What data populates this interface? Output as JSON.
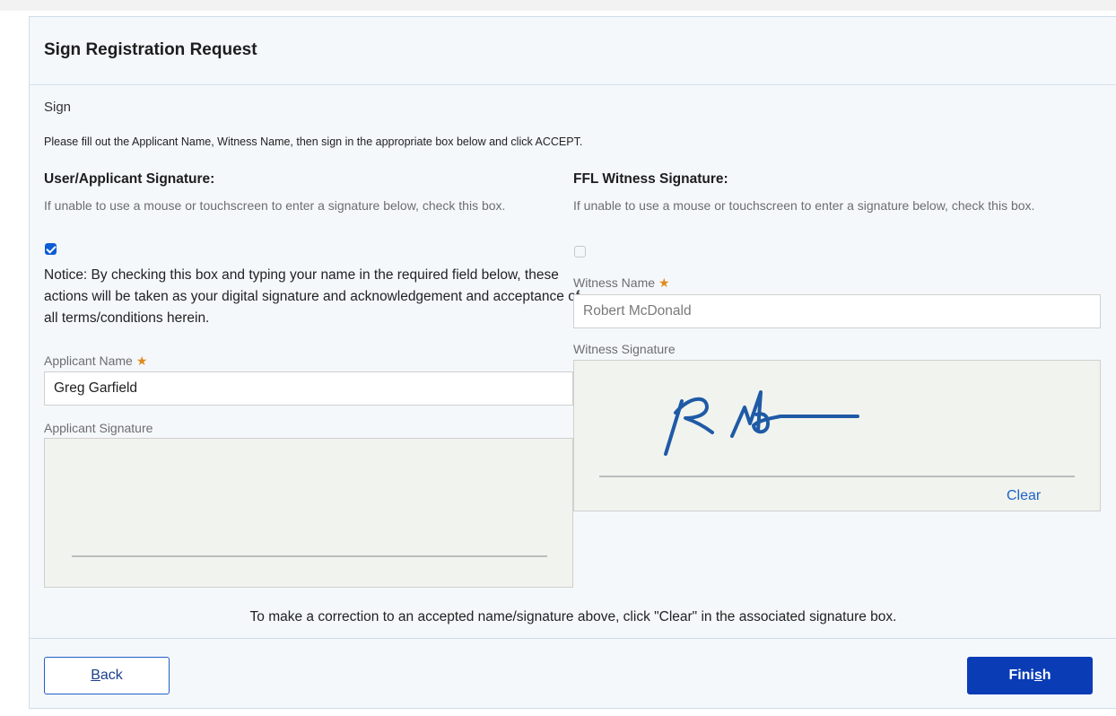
{
  "modal": {
    "title": "Sign Registration Request",
    "section_label": "Sign",
    "instruction": "Please fill out the Applicant Name, Witness Name, then sign in the appropriate box below and click ACCEPT."
  },
  "applicant": {
    "heading": "User/Applicant Signature:",
    "hint": "If unable to use a mouse or touchscreen to enter a signature below, check this box.",
    "checkbox_checked": true,
    "notice": "Notice: By checking this box and typing your name in the required field below, these actions will be taken as your digital signature and acknowledgement and acceptance of all terms/conditions herein.",
    "name_label": "Applicant Name",
    "name_value": "Greg Garfield",
    "signature_label": "Applicant Signature"
  },
  "witness": {
    "heading": "FFL Witness Signature:",
    "hint": "If unable to use a mouse or touchscreen to enter a signature below, check this box.",
    "checkbox_checked": false,
    "name_label": "Witness Name",
    "name_value": "Robert McDonald",
    "signature_label": "Witness Signature",
    "clear_label": "Clear"
  },
  "required_marker": "★",
  "correction_note": "To make a correction to an accepted name/signature above, click \"Clear\" in the associated signature box.",
  "footer": {
    "back": {
      "before": "",
      "mnemonic": "B",
      "after": "ack"
    },
    "finish": {
      "before": "Fini",
      "mnemonic": "s",
      "after": "h"
    }
  },
  "colors": {
    "primary_button": "#0a3cb6",
    "link": "#1a63c7",
    "checkbox_checked": "#0b5cd5",
    "required_star": "#e08a1e",
    "signature_ink": "#1f5aa6",
    "signature_pad": "#f1f3ee"
  }
}
